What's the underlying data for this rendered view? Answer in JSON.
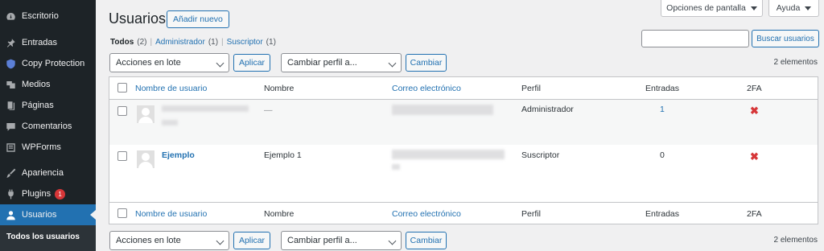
{
  "sidebar": {
    "items": [
      {
        "label": "Escritorio",
        "icon": "dashboard-icon"
      },
      {
        "label": "Entradas",
        "icon": "pin-icon"
      },
      {
        "label": "Copy Protection",
        "icon": "shield-icon"
      },
      {
        "label": "Medios",
        "icon": "media-icon"
      },
      {
        "label": "Páginas",
        "icon": "pages-icon"
      },
      {
        "label": "Comentarios",
        "icon": "comment-icon"
      },
      {
        "label": "WPForms",
        "icon": "forms-icon"
      },
      {
        "label": "Apariencia",
        "icon": "brush-icon"
      },
      {
        "label": "Plugins",
        "icon": "plug-icon",
        "badge": "1"
      },
      {
        "label": "Usuarios",
        "icon": "user-icon"
      }
    ],
    "submenu": {
      "label": "Todos los usuarios"
    }
  },
  "top": {
    "screen_options": "Opciones de pantalla",
    "help": "Ayuda"
  },
  "header": {
    "title": "Usuarios",
    "add_new": "Añadir nuevo"
  },
  "filters": {
    "all_label": "Todos",
    "all_count": "(2)",
    "admin_label": "Administrador",
    "admin_count": "(1)",
    "sub_label": "Suscriptor",
    "sub_count": "(1)",
    "separator": "|"
  },
  "search": {
    "button": "Buscar usuarios",
    "value": ""
  },
  "bulk": {
    "actions": "Acciones en lote",
    "apply": "Aplicar",
    "change_role": "Cambiar perfil a...",
    "change": "Cambiar",
    "count": "2 elementos"
  },
  "table": {
    "columns": {
      "username": "Nombre de usuario",
      "name": "Nombre",
      "email": "Correo electrónico",
      "role": "Perfil",
      "posts": "Entradas",
      "twofa": "2FA"
    },
    "rows": [
      {
        "username": "",
        "name": "—",
        "email": "",
        "role": "Administrador",
        "posts": "1",
        "twofa": "✖"
      },
      {
        "username": "Ejemplo",
        "name": "Ejemplo 1",
        "email": "",
        "role": "Suscriptor",
        "posts": "0",
        "twofa": "✖"
      }
    ]
  },
  "colors": {
    "accent": "#2271b1",
    "sidebar": "#1d2327",
    "danger": "#d63638"
  }
}
